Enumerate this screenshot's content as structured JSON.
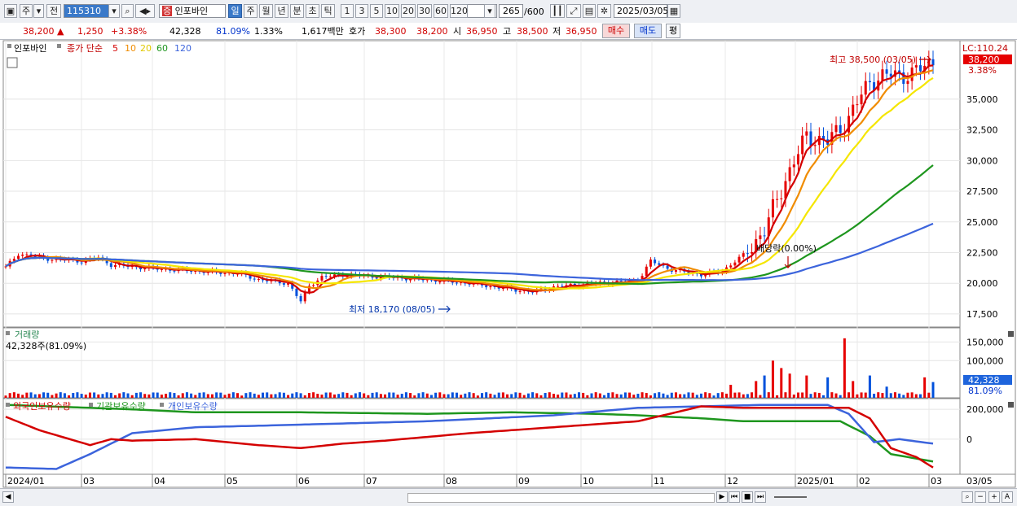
{
  "toolbar": {
    "market_button": "주",
    "prev_button": "전",
    "code_value": "115310",
    "stock_name": "인포바인",
    "period_buttons": [
      "일",
      "주",
      "월",
      "년",
      "분",
      "초",
      "틱"
    ],
    "period_selected": "일",
    "interval_buttons": [
      "1",
      "3",
      "5",
      "10",
      "20",
      "30",
      "60",
      "120"
    ],
    "count_value": "265",
    "count_total": "/600",
    "date_value": "2025/03/05"
  },
  "quote": {
    "price": "38,200",
    "change": "1,250",
    "change_pct": "+3.38%",
    "volume": "42,328",
    "volume_ratio": "81.09%",
    "turnover_pct": "1.33%",
    "amount": "1,617백만",
    "bid_label": "호가",
    "bid": "38,300",
    "ask": "38,200",
    "open_label": "시",
    "open": "36,950",
    "high_label": "고",
    "high": "38,500",
    "low_label": "저",
    "low": "36,950",
    "buy_button": "매수",
    "sell_button": "매도",
    "eval_button": "평"
  },
  "legend": {
    "name": "인포바인",
    "type": "종가 단순",
    "ma": [
      "5",
      "10",
      "20",
      "60",
      "120"
    ],
    "volume_title": "거래량",
    "volume_value": "42,328주(81.09%)",
    "holdings": [
      "외국인보유수량",
      "기관보유수량",
      "개인보유수량"
    ]
  },
  "annotations": {
    "high": "최고 38,500 (03/05)",
    "low": "최저 18,170 (08/05)",
    "dividend": "배당락(0.00%)",
    "lc": "LC:110.24",
    "last_price": "38,200",
    "last_pct": "3.38%",
    "last_volume": "42,328",
    "last_volume_pct": "81.09%"
  },
  "colors": {
    "up": "#e60000",
    "down": "#0050dc",
    "ma5": "#d40000",
    "ma10": "#f08c00",
    "ma20": "#f5e600",
    "ma60": "#1e961e",
    "ma120": "#3c64dc"
  },
  "chart_data": {
    "type": "line",
    "price_axis": {
      "ticks": [
        "35,000",
        "32,500",
        "30,000",
        "27,500",
        "25,000",
        "22,500",
        "20,000",
        "17,500"
      ],
      "ylim": [
        16500,
        39500
      ]
    },
    "volume_axis": {
      "ticks": [
        "150,000",
        "100,000"
      ]
    },
    "holdings_axis": {
      "ticks": [
        "200,000",
        "0"
      ]
    },
    "x_labels": [
      "2024/01",
      "03",
      "04",
      "05",
      "06",
      "07",
      "08",
      "09",
      "10",
      "11",
      "12",
      "2025/01",
      "02",
      "03"
    ],
    "x_right_label": "03/05",
    "close_keypoints": [
      [
        0,
        21300
      ],
      [
        3,
        22400
      ],
      [
        10,
        22000
      ],
      [
        18,
        21800
      ],
      [
        22,
        22100
      ],
      [
        25,
        21500
      ],
      [
        35,
        21200
      ],
      [
        45,
        21000
      ],
      [
        55,
        20800
      ],
      [
        60,
        20300
      ],
      [
        67,
        20000
      ],
      [
        70,
        18500
      ],
      [
        72,
        19800
      ],
      [
        75,
        20500
      ],
      [
        80,
        20700
      ],
      [
        90,
        20500
      ],
      [
        100,
        20300
      ],
      [
        110,
        20000
      ],
      [
        120,
        19500
      ],
      [
        125,
        19300
      ],
      [
        130,
        19700
      ],
      [
        140,
        20000
      ],
      [
        150,
        20200
      ],
      [
        153,
        21800
      ],
      [
        158,
        21100
      ],
      [
        165,
        20700
      ],
      [
        170,
        21000
      ],
      [
        175,
        22300
      ],
      [
        180,
        24300
      ],
      [
        185,
        28500
      ],
      [
        190,
        32000
      ],
      [
        195,
        31500
      ],
      [
        200,
        33500
      ],
      [
        205,
        36500
      ],
      [
        210,
        37000
      ],
      [
        215,
        37000
      ],
      [
        220,
        38200
      ]
    ],
    "ma_series": [
      {
        "name": "5",
        "period": 5
      },
      {
        "name": "10",
        "period": 10
      },
      {
        "name": "20",
        "period": 20
      },
      {
        "name": "60",
        "period": 60
      },
      {
        "name": "120",
        "period": 120
      }
    ],
    "volume_spikes": [
      [
        172,
        35000
      ],
      [
        178,
        45000
      ],
      [
        180,
        60000
      ],
      [
        182,
        100000
      ],
      [
        184,
        80000
      ],
      [
        186,
        65000
      ],
      [
        190,
        60000
      ],
      [
        195,
        55000
      ],
      [
        199,
        160000
      ],
      [
        201,
        45000
      ],
      [
        205,
        60000
      ],
      [
        209,
        30000
      ],
      [
        218,
        55000
      ],
      [
        220,
        42328
      ]
    ],
    "holdings": {
      "foreign": [
        [
          0,
          150000
        ],
        [
          8,
          60000
        ],
        [
          20,
          -40000
        ],
        [
          25,
          0
        ],
        [
          30,
          -10000
        ],
        [
          45,
          0
        ],
        [
          60,
          -40000
        ],
        [
          70,
          -60000
        ],
        [
          80,
          -30000
        ],
        [
          90,
          -10000
        ],
        [
          110,
          40000
        ],
        [
          150,
          120000
        ],
        [
          165,
          220000
        ],
        [
          175,
          210000
        ],
        [
          200,
          210000
        ],
        [
          205,
          140000
        ],
        [
          210,
          -60000
        ],
        [
          216,
          -120000
        ],
        [
          220,
          -190000
        ]
      ],
      "institution": [
        [
          0,
          230000
        ],
        [
          20,
          210000
        ],
        [
          30,
          200000
        ],
        [
          45,
          180000
        ],
        [
          70,
          180000
        ],
        [
          100,
          170000
        ],
        [
          120,
          180000
        ],
        [
          140,
          170000
        ],
        [
          150,
          160000
        ],
        [
          165,
          140000
        ],
        [
          175,
          120000
        ],
        [
          198,
          120000
        ],
        [
          205,
          20000
        ],
        [
          210,
          -100000
        ],
        [
          220,
          -150000
        ]
      ],
      "individual": [
        [
          0,
          -190000
        ],
        [
          12,
          -200000
        ],
        [
          20,
          -100000
        ],
        [
          30,
          40000
        ],
        [
          45,
          80000
        ],
        [
          60,
          90000
        ],
        [
          100,
          120000
        ],
        [
          130,
          160000
        ],
        [
          150,
          210000
        ],
        [
          180,
          230000
        ],
        [
          195,
          230000
        ],
        [
          200,
          170000
        ],
        [
          206,
          -20000
        ],
        [
          212,
          0
        ],
        [
          220,
          -30000
        ]
      ]
    }
  }
}
